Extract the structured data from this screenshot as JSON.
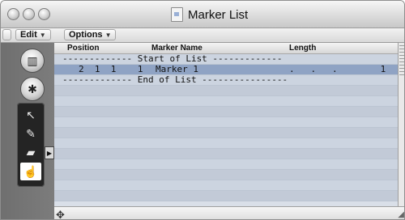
{
  "window": {
    "title": "Marker List"
  },
  "menu": {
    "edit_label": "Edit",
    "options_label": "Options"
  },
  "table": {
    "columns": [
      "Position",
      "Marker Name",
      "Length"
    ],
    "start_row": "------------- Start of List -------------",
    "marker_row": {
      "position": "2  1  1    1",
      "name": "Marker 1",
      "length": ".   .   .        1"
    },
    "end_row": "------------- End of List ----------------"
  },
  "colors": {
    "selected_row": "#8fa3c4",
    "list_bg": "#c9d2df",
    "sidebar": "#757575"
  },
  "icons": [
    "book-icon",
    "person-icon",
    "pointer-tool-icon",
    "pencil-tool-icon",
    "eraser-tool-icon",
    "hand-tool-icon"
  ]
}
